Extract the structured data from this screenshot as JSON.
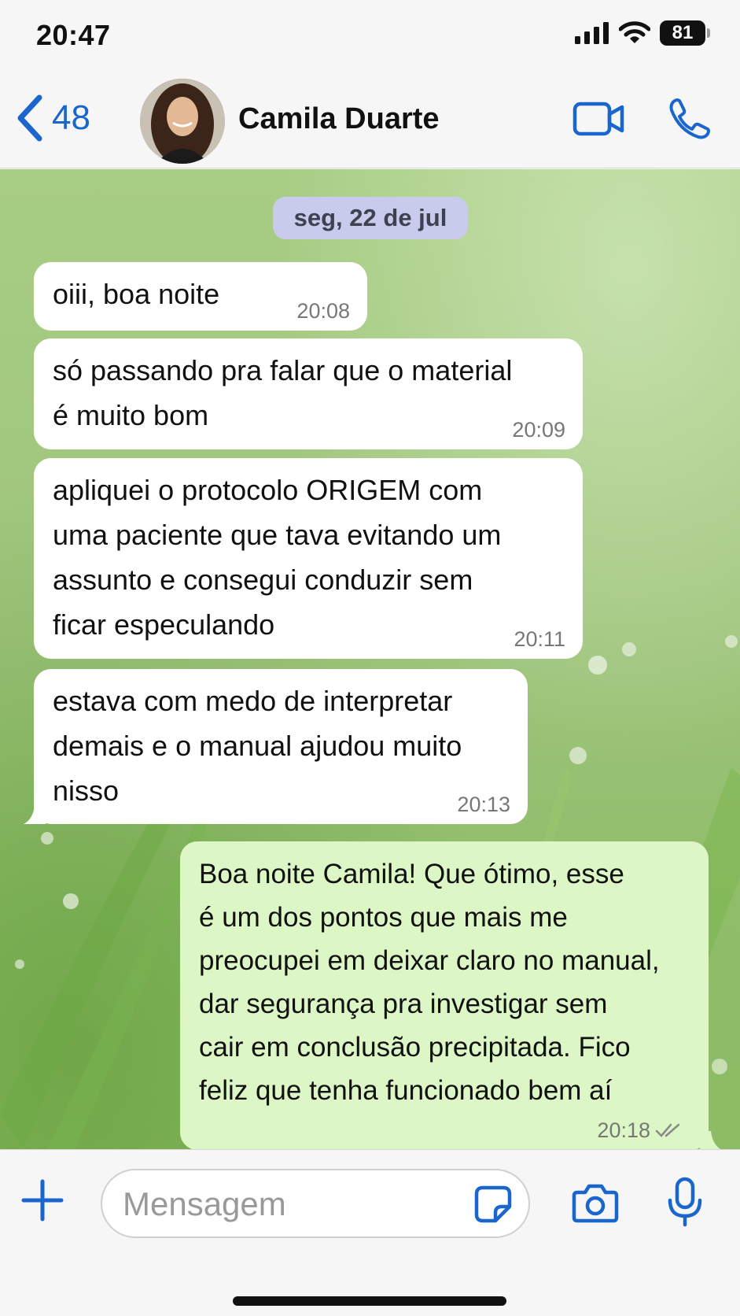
{
  "status": {
    "time": "20:47",
    "battery": "81",
    "icons": [
      "signal-icon",
      "wifi-icon",
      "battery-icon"
    ]
  },
  "header": {
    "back_count": "48",
    "contact_name": "Camila Duarte",
    "accent": "#1a66cc"
  },
  "chat": {
    "date_label": "seg, 22 de jul",
    "messages": [
      {
        "direction": "in",
        "lines": [
          "oiii, boa noite"
        ],
        "time": "20:08"
      },
      {
        "direction": "in",
        "lines": [
          "só passando pra falar que o material",
          "é muito bom"
        ],
        "time": "20:09"
      },
      {
        "direction": "in",
        "lines": [
          "apliquei o protocolo ORIGEM com",
          "uma paciente que tava evitando um",
          "assunto e consegui conduzir sem",
          "ficar especulando"
        ],
        "time": "20:11"
      },
      {
        "direction": "in",
        "lines": [
          "estava com medo de interpretar",
          "demais e o manual ajudou muito",
          "nisso"
        ],
        "time": "20:13"
      },
      {
        "direction": "out",
        "lines": [
          "Boa noite Camila! Que ótimo, esse",
          "é um dos pontos que mais me",
          "preocupei em deixar claro no manual,",
          "dar segurança pra investigar sem",
          "cair em conclusão precipitada. Fico",
          "feliz que tenha funcionado bem aí"
        ],
        "time": "20:18",
        "status": "read"
      }
    ]
  },
  "composer": {
    "placeholder": "Mensagem",
    "value": ""
  },
  "colors": {
    "incoming_bubble": "#ffffff",
    "outgoing_bubble": "#dcf7c5",
    "date_pill": "#c9cbed"
  }
}
